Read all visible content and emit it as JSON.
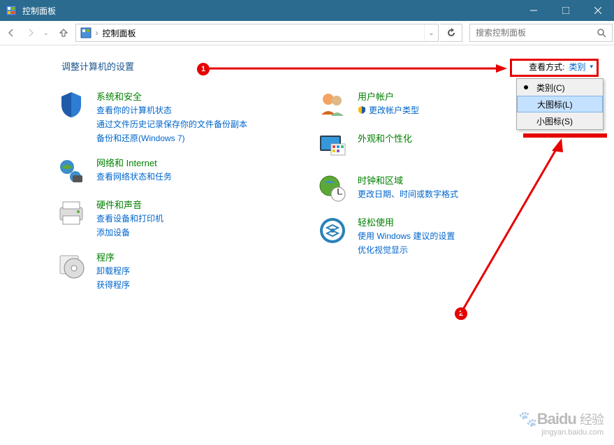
{
  "window": {
    "title": "控制面板"
  },
  "toolbar": {
    "address": "控制面板",
    "address_sep": "›",
    "search_placeholder": "搜索控制面板"
  },
  "heading": "调整计算机的设置",
  "view": {
    "label": "查看方式:",
    "value": "类别"
  },
  "categories_left": [
    {
      "title": "系统和安全",
      "links": [
        "查看你的计算机状态",
        "通过文件历史记录保存你的文件备份副本",
        "备份和还原(Windows 7)"
      ]
    },
    {
      "title": "网络和 Internet",
      "links": [
        "查看网络状态和任务"
      ]
    },
    {
      "title": "硬件和声音",
      "links": [
        "查看设备和打印机",
        "添加设备"
      ]
    },
    {
      "title": "程序",
      "links": [
        "卸载程序",
        "获得程序"
      ]
    }
  ],
  "categories_right": [
    {
      "title": "用户帐户",
      "links_prefix": [
        "更改帐户类型"
      ]
    },
    {
      "title": "外观和个性化",
      "links": []
    },
    {
      "title": "时钟和区域",
      "links": [
        "更改日期、时间或数字格式"
      ]
    },
    {
      "title": "轻松使用",
      "links": [
        "使用 Windows 建议的设置",
        "优化视觉显示"
      ]
    }
  ],
  "dropdown": {
    "items": [
      "类别(C)",
      "大图标(L)",
      "小图标(S)"
    ]
  },
  "annotations": {
    "badge1": "1",
    "badge2": "2"
  },
  "watermark": {
    "brand": "Baidu",
    "suffix": "经验",
    "url": "jingyan.baidu.com"
  }
}
